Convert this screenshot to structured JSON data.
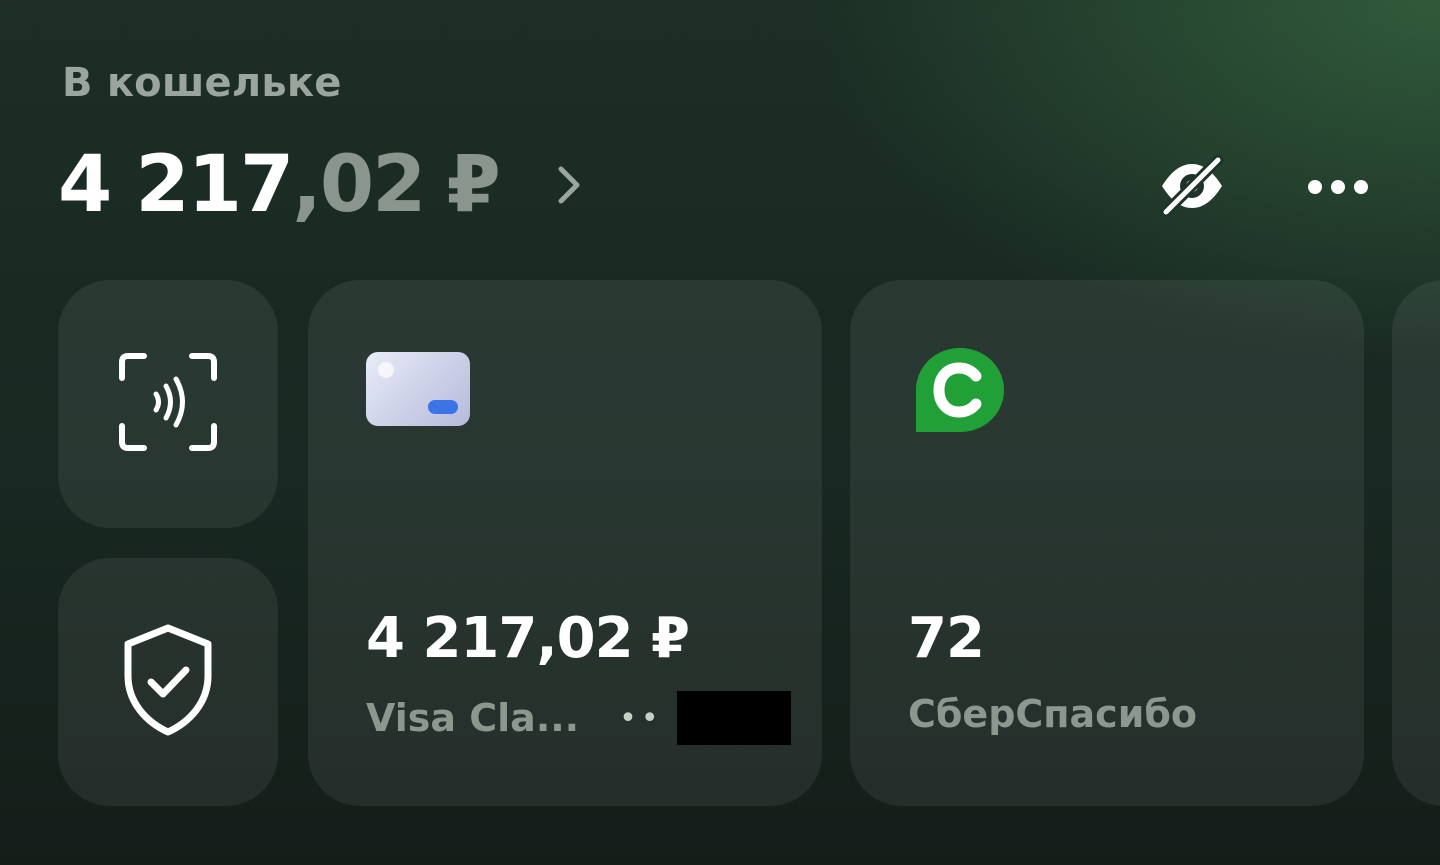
{
  "wallet": {
    "label": "В кошельке",
    "balance_int": "4 217",
    "balance_frac": ",02",
    "currency": "₽"
  },
  "tiles": {
    "card": {
      "amount": "4 217,02 ₽",
      "name": "Visa Cla...",
      "mask": "••"
    },
    "spasibo": {
      "amount": "72",
      "name": "СберСпасибо",
      "logo_letter": "С"
    }
  },
  "colors": {
    "accent_green": "#21a038",
    "card_chip": "#3b74e6"
  },
  "icons": {
    "balance_chevron": "chevron-right-icon",
    "hide_balance": "eye-off-icon",
    "more": "more-dots-icon",
    "nfc_pay": "nfc-scan-icon",
    "security": "shield-check-icon",
    "card": "card-thumbnail-icon",
    "spasibo": "spasibo-logo-icon"
  }
}
